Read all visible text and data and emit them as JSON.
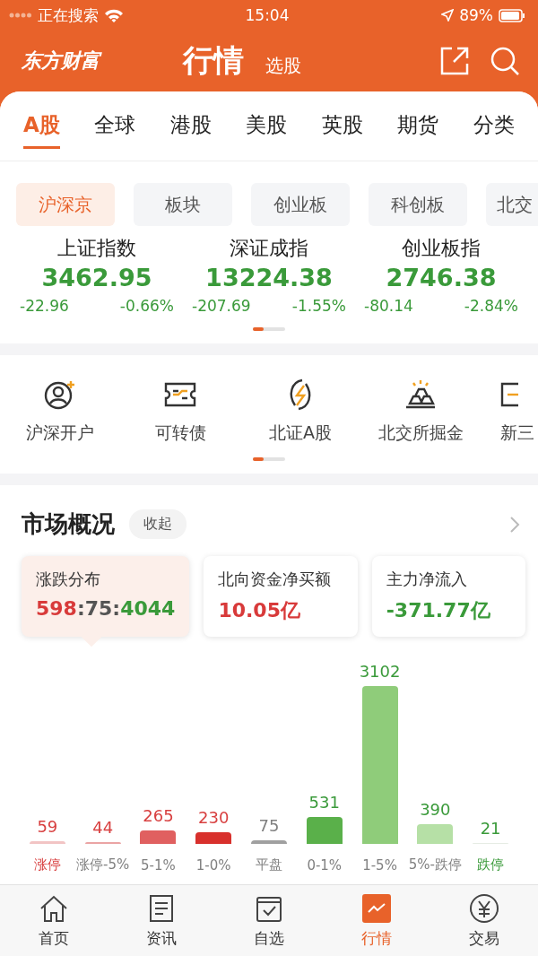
{
  "status_bar": {
    "carrier": "正在搜索",
    "time": "15:04",
    "battery": "89%"
  },
  "header": {
    "logo": "东方财富",
    "title": "行情",
    "subtitle": "选股"
  },
  "tabs": [
    {
      "label": "A股",
      "selected": true
    },
    {
      "label": "全球",
      "selected": false
    },
    {
      "label": "港股",
      "selected": false
    },
    {
      "label": "美股",
      "selected": false
    },
    {
      "label": "英股",
      "selected": false
    },
    {
      "label": "期货",
      "selected": false
    },
    {
      "label": "分类",
      "selected": false
    }
  ],
  "market_tabs": [
    {
      "label": "沪深京",
      "selected": true
    },
    {
      "label": "板块",
      "selected": false
    },
    {
      "label": "创业板",
      "selected": false
    },
    {
      "label": "科创板",
      "selected": false
    },
    {
      "label": "北交",
      "selected": false
    }
  ],
  "indices": [
    {
      "name": "上证指数",
      "value": "3462.95",
      "change": "-22.96",
      "percent": "-0.66%"
    },
    {
      "name": "深证成指",
      "value": "13224.38",
      "change": "-207.69",
      "percent": "-1.55%"
    },
    {
      "name": "创业板指",
      "value": "2746.38",
      "change": "-80.14",
      "percent": "-2.84%"
    }
  ],
  "shortcuts": [
    {
      "label": "沪深开户",
      "kind": "account"
    },
    {
      "label": "可转债",
      "kind": "bond"
    },
    {
      "label": "北证A股",
      "kind": "bolt"
    },
    {
      "label": "北交所掘金",
      "kind": "gold"
    },
    {
      "label": "新三",
      "kind": "board"
    }
  ],
  "market_overview": {
    "title": "市场概况",
    "toggle": "收起",
    "cards": [
      {
        "title": "涨跌分布",
        "selected": true,
        "parts": [
          {
            "text": "598",
            "color": "#d83a3a"
          },
          {
            "text": ":75:",
            "color": "#555555"
          },
          {
            "text": "4044",
            "color": "#3a9a3a"
          }
        ]
      },
      {
        "title": "北向资金净买额",
        "selected": false,
        "parts": [
          {
            "text": "10.05亿",
            "color": "#d83a3a"
          }
        ]
      },
      {
        "title": "主力净流入",
        "selected": false,
        "parts": [
          {
            "text": "-371.77亿",
            "color": "#3a9a3a"
          }
        ]
      }
    ],
    "chart_data": {
      "type": "bar",
      "categories": [
        "涨停",
        "涨停-5%",
        "5-1%",
        "1-0%",
        "平盘",
        "0-1%",
        "1-5%",
        "5%-跌停",
        "跌停"
      ],
      "values": [
        59,
        44,
        265,
        230,
        75,
        531,
        3102,
        390,
        21
      ],
      "colors": [
        "#f2c4c4",
        "#eaa4a4",
        "#e06060",
        "#d8302c",
        "#a0a0a0",
        "#5ab04a",
        "#8fcc7a",
        "#b6e0a6",
        "#e6ece4"
      ],
      "data_labels": true
    }
  },
  "bottom_nav": [
    {
      "label": "首页",
      "selected": false
    },
    {
      "label": "资讯",
      "selected": false
    },
    {
      "label": "自选",
      "selected": false
    },
    {
      "label": "行情",
      "selected": true
    },
    {
      "label": "交易",
      "selected": false
    }
  ]
}
